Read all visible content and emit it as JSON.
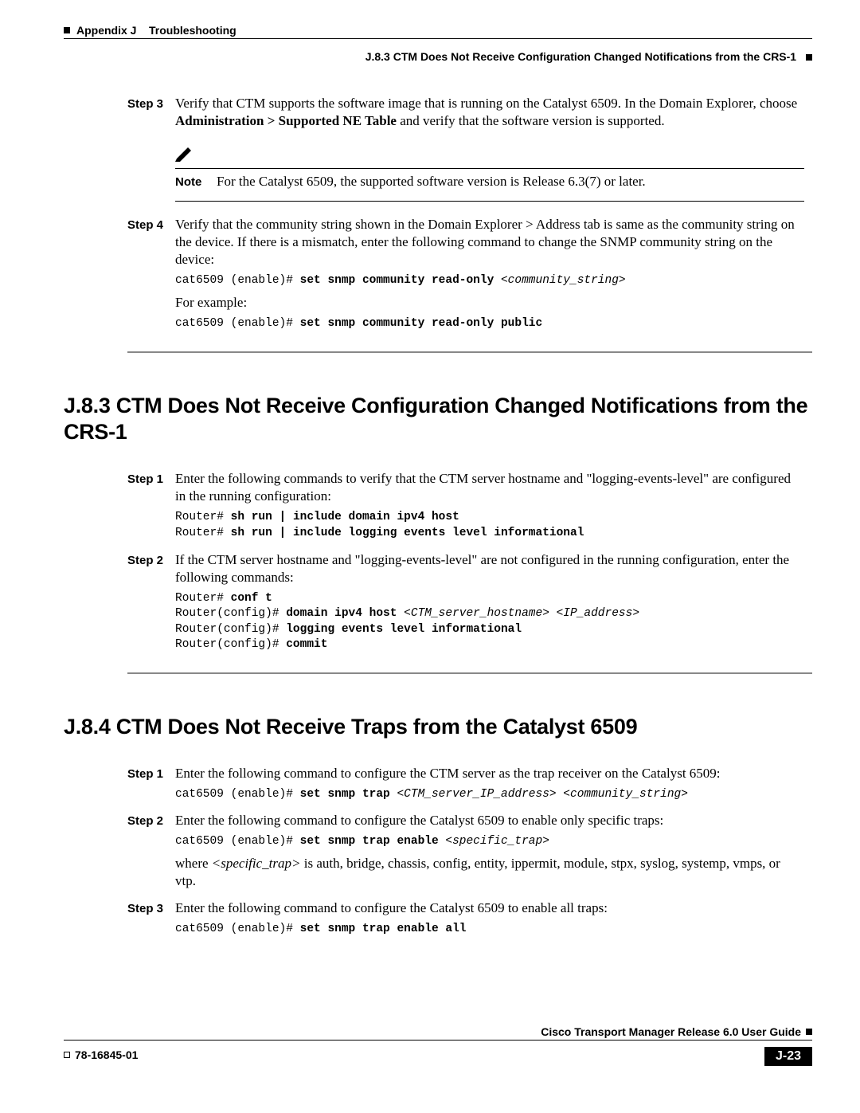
{
  "header": {
    "appendix": "Appendix J",
    "appendix_title": "Troubleshooting",
    "section_line": "J.8.3   CTM Does Not Receive Configuration Changed Notifications from the CRS-1"
  },
  "sectionA": {
    "step3": {
      "label": "Step 3",
      "text_pre": "Verify that CTM supports the software image that is running on the Catalyst 6509. In the Domain Explorer, choose ",
      "bold": "Administration > Supported NE Table",
      "text_post": " and verify that the software version is supported."
    },
    "note": {
      "label": "Note",
      "text": "For the Catalyst 6509, the supported software version is Release 6.3(7) or later."
    },
    "step4": {
      "label": "Step 4",
      "text": "Verify that the community string shown in the Domain Explorer > Address tab is same as the community string on the device. If there is a mismatch, enter the following command to change the SNMP community string on the device:",
      "code1_prefix": "cat6509 (enable)# ",
      "code1_bold": "set snmp community read-only ",
      "code1_italic": "<community_string>",
      "for_example": "For example:",
      "code2_prefix": "cat6509 (enable)# ",
      "code2_bold": "set snmp community read-only public"
    }
  },
  "sectionB": {
    "heading": "J.8.3  CTM Does Not Receive Configuration Changed Notifications from the CRS-1",
    "step1": {
      "label": "Step 1",
      "text": "Enter the following commands to verify that the CTM server hostname and \"logging-events-level\" are configured in the running configuration:",
      "code_l1_prefix": "Router# ",
      "code_l1_bold": "sh run | include domain ipv4 host",
      "code_l2_prefix": "Router# ",
      "code_l2_bold": "sh run | include logging events level informational"
    },
    "step2": {
      "label": "Step 2",
      "text": "If the CTM server hostname and \"logging-events-level\" are not configured in the running configuration, enter the following commands:",
      "code_l1_prefix": "Router# ",
      "code_l1_bold": "conf t",
      "code_l2_prefix": "Router(config)# ",
      "code_l2_bold": "domain ipv4 host ",
      "code_l2_italic": "<CTM_server_hostname> <IP_address>",
      "code_l3_prefix": "Router(config)# ",
      "code_l3_bold": "logging events level informational",
      "code_l4_prefix": "Router(config)# ",
      "code_l4_bold": "commit"
    }
  },
  "sectionC": {
    "heading": "J.8.4  CTM Does Not Receive Traps from the Catalyst 6509",
    "step1": {
      "label": "Step 1",
      "text": "Enter the following command to configure the CTM server as the trap receiver on the Catalyst 6509:",
      "code_prefix": "cat6509 (enable)# ",
      "code_bold": "set snmp trap ",
      "code_italic": "<CTM_server_IP_address> <community_string>"
    },
    "step2": {
      "label": "Step 2",
      "text": "Enter the following command to configure the Catalyst 6509 to enable only specific traps:",
      "code_prefix": "cat6509 (enable)# ",
      "code_bold": "set snmp trap enable ",
      "code_italic": "<specific_trap>",
      "where_pre": "where ",
      "where_italic": "<specific_trap>",
      "where_post": " is auth, bridge, chassis, config, entity, ippermit, module, stpx, syslog, systemp, vmps, or vtp."
    },
    "step3": {
      "label": "Step 3",
      "text": "Enter the following command to configure the Catalyst 6509 to enable all traps:",
      "code_prefix": "cat6509 (enable)# ",
      "code_bold": "set snmp trap enable all"
    }
  },
  "footer": {
    "guide": "Cisco Transport Manager Release 6.0 User Guide",
    "docnum": "78-16845-01",
    "pagenum": "J-23"
  }
}
